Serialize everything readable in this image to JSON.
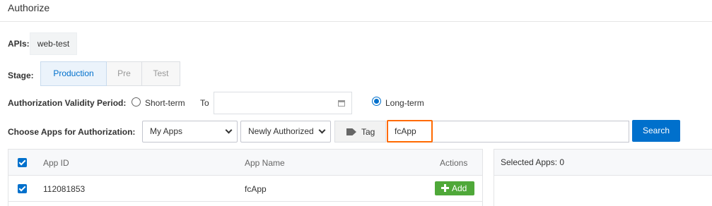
{
  "dialog": {
    "title": "Authorize"
  },
  "apis": {
    "label": "APIs:",
    "value": "web-test"
  },
  "stage": {
    "label": "Stage:",
    "options": [
      "Production",
      "Pre",
      "Test"
    ],
    "selected": "Production"
  },
  "validity": {
    "label": "Authorization Validity Period:",
    "short_term": "Short-term",
    "to": "To",
    "date_value": "",
    "long_term": "Long-term",
    "selected": "Long-term"
  },
  "choose": {
    "label": "Choose Apps for Authorization:",
    "apps_select": "My Apps",
    "filter_select": "Newly Authorized",
    "tag_label": "Tag",
    "search_value": "fcApp",
    "search_button": "Search"
  },
  "table": {
    "columns": [
      "App ID",
      "App Name",
      "Actions"
    ],
    "rows": [
      {
        "id": "112081853",
        "name": "fcApp",
        "action": "Add",
        "checked": true
      }
    ],
    "header_checked": true
  },
  "selected": {
    "label": "Selected Apps: 0"
  },
  "colors": {
    "accent": "#0070cc",
    "add": "#4fa839",
    "highlight": "#ff6a00"
  }
}
